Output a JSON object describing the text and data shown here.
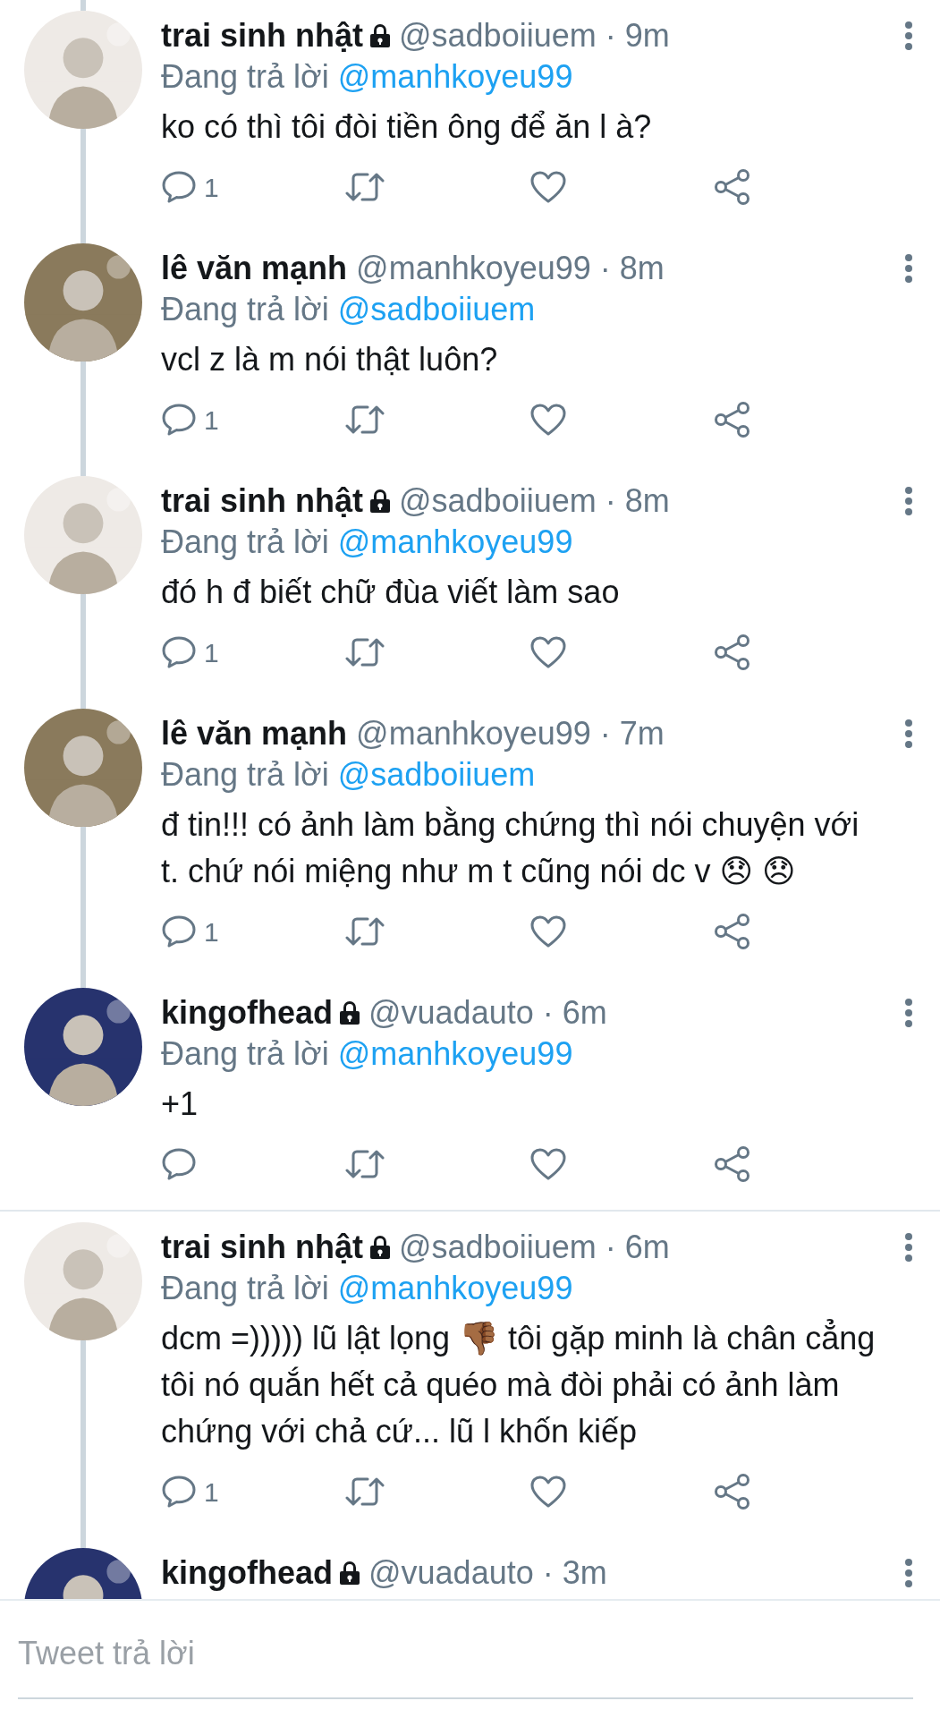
{
  "tweets": [
    {
      "name": "trai sinh nhật",
      "locked": true,
      "handle": "@sadboiiuem",
      "time": "· 9m",
      "replying_label": "Đang trả lời",
      "replying_to": "@manhkoyeu99",
      "text": "ko có thì tôi đòi tiền ông để ăn l à?",
      "replies": "1",
      "line_above": true,
      "line_below": true,
      "divider_below": false
    },
    {
      "name": "lê văn mạnh",
      "locked": false,
      "handle": "@manhkoyeu99",
      "time": "· 8m",
      "replying_label": "Đang trả lời",
      "replying_to": "@sadboiiuem",
      "text": "vcl z là m nói thật luôn?",
      "replies": "1",
      "line_above": true,
      "line_below": true,
      "divider_below": false
    },
    {
      "name": "trai sinh nhật",
      "locked": true,
      "handle": "@sadboiiuem",
      "time": "· 8m",
      "replying_label": "Đang trả lời",
      "replying_to": "@manhkoyeu99",
      "text": "đó h đ biết chữ đùa viết làm sao",
      "replies": "1",
      "line_above": true,
      "line_below": true,
      "divider_below": false
    },
    {
      "name": "lê văn mạnh",
      "locked": false,
      "handle": "@manhkoyeu99",
      "time": "· 7m",
      "replying_label": "Đang trả lời",
      "replying_to": "@sadboiiuem",
      "text": "đ tin!!! có ảnh làm bằng chứng thì nói chuyện với t. chứ nói miệng như m t cũng nói dc v 😞 😞",
      "replies": "1",
      "line_above": true,
      "line_below": true,
      "divider_below": false
    },
    {
      "name": "kingofhead",
      "locked": true,
      "handle": "@vuadauto",
      "time": "· 6m",
      "replying_label": "Đang trả lời",
      "replying_to": "@manhkoyeu99",
      "text": "+1",
      "line_above": true,
      "line_below": false,
      "divider_below": true
    },
    {
      "name": "trai sinh nhật",
      "locked": true,
      "handle": "@sadboiiuem",
      "time": "· 6m",
      "replying_label": "Đang trả lời",
      "replying_to": "@manhkoyeu99",
      "text": "dcm =))))) lũ lật lọng 👎🏾  tôi gặp minh là chân cẳng tôi nó quắn hết cả quéo mà đòi phải có ảnh làm chứng với chả cứ... lũ l khốn kiếp",
      "replies": "1",
      "line_above": false,
      "line_below": true,
      "divider_below": false
    },
    {
      "name": "kingofhead",
      "locked": true,
      "handle": "@vuadauto",
      "time": "· 3m",
      "line_above": true,
      "line_below": false,
      "divider_below": false
    }
  ],
  "reply_bar": {
    "placeholder": "Tweet trả lời"
  }
}
